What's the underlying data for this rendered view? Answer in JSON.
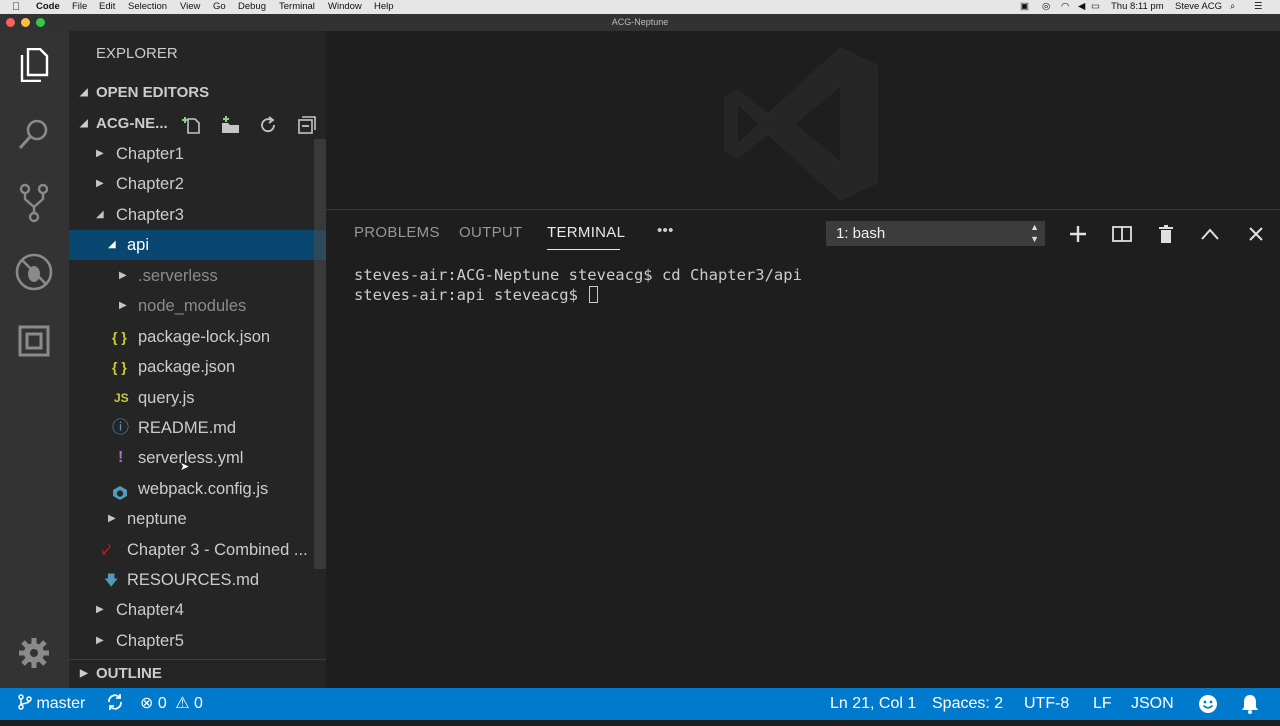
{
  "menubar": {
    "app": "Code",
    "items": [
      "File",
      "Edit",
      "Selection",
      "View",
      "Go",
      "Debug",
      "Terminal",
      "Window",
      "Help"
    ],
    "clock": "Thu 8:11 pm",
    "user": "Steve ACG"
  },
  "window": {
    "title": "ACG-Neptune"
  },
  "sidebar": {
    "title": "EXPLORER",
    "open_editors": "OPEN EDITORS",
    "folder": "ACG-NE...",
    "outline": "OUTLINE",
    "tree": [
      {
        "label": "Chapter1"
      },
      {
        "label": "Chapter2"
      },
      {
        "label": "Chapter3"
      },
      {
        "label": "api"
      },
      {
        "label": ".serverless"
      },
      {
        "label": "node_modules"
      },
      {
        "label": "package-lock.json",
        "icon": "{ }"
      },
      {
        "label": "package.json",
        "icon": "{ }"
      },
      {
        "label": "query.js",
        "icon": "JS"
      },
      {
        "label": "README.md",
        "icon": "ⓘ"
      },
      {
        "label": "serverless.yml",
        "icon": "!"
      },
      {
        "label": "webpack.config.js"
      },
      {
        "label": "neptune"
      },
      {
        "label": "Chapter 3 - Combined ..."
      },
      {
        "label": "RESOURCES.md"
      },
      {
        "label": "Chapter4"
      },
      {
        "label": "Chapter5"
      }
    ]
  },
  "panel": {
    "tabs": [
      "PROBLEMS",
      "OUTPUT",
      "TERMINAL"
    ],
    "more": "•••",
    "terminal_select": "1: bash",
    "lines": [
      "steves-air:ACG-Neptune steveacg$ cd Chapter3/api",
      "steves-air:api steveacg$ "
    ]
  },
  "statusbar": {
    "branch": "master",
    "errors": "0",
    "warnings": "0",
    "position": "Ln 21, Col 1",
    "spaces": "Spaces: 2",
    "encoding": "UTF-8",
    "eol": "LF",
    "language": "JSON"
  },
  "colors": {
    "statusbar": "#007acc",
    "selection": "#094771",
    "json_icon": "#cbcb41",
    "yaml_icon": "#a074c4",
    "info_icon": "#519aba"
  }
}
